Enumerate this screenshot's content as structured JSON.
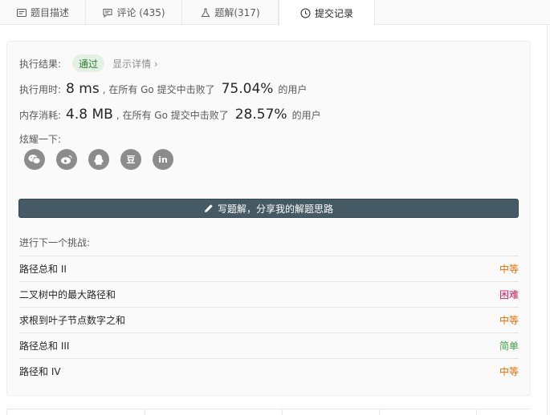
{
  "tabs": [
    {
      "label": "题目描述",
      "icon": "description-icon"
    },
    {
      "label": "评论 (435)",
      "icon": "comment-icon"
    },
    {
      "label": "题解(317)",
      "icon": "flask-icon"
    },
    {
      "label": "提交记录",
      "icon": "clock-icon",
      "active": true
    }
  ],
  "result": {
    "label": "执行结果:",
    "status": "通过",
    "detail_link": "显示详情 ›"
  },
  "runtime": {
    "label": "执行用时:",
    "value": "8 ms",
    "mid_text": ", 在所有 Go 提交中击败了",
    "percent": "75.04%",
    "suffix": "的用户"
  },
  "memory": {
    "label": "内存消耗:",
    "value": "4.8 MB",
    "mid_text": ", 在所有 Go 提交中击败了",
    "percent": "28.57%",
    "suffix": "的用户"
  },
  "share": {
    "label": "炫耀一下:",
    "icons": [
      "wechat-icon",
      "weibo-icon",
      "qq-icon",
      "douban-icon",
      "linkedin-icon"
    ],
    "douban_glyph": "豆",
    "linkedin_glyph": "in"
  },
  "write_solution": {
    "label": "写题解，分享我的解题思路"
  },
  "next_challenges": {
    "title": "进行下一个挑战:",
    "items": [
      {
        "name": "路径总和 II",
        "difficulty": "中等",
        "color": "#ef6c00"
      },
      {
        "name": "二叉树中的最大路径和",
        "difficulty": "困难",
        "color": "#d81b60"
      },
      {
        "name": "求根到叶子节点数字之和",
        "difficulty": "中等",
        "color": "#ef6c00"
      },
      {
        "name": "路径总和 III",
        "difficulty": "简单",
        "color": "#43a047"
      },
      {
        "name": "路径和 IV",
        "difficulty": "中等",
        "color": "#ef6c00"
      }
    ]
  },
  "colors": {
    "accepted_bg": "#e3f1e4",
    "accepted_text": "#2e7d32",
    "button_bg": "#455a64"
  }
}
